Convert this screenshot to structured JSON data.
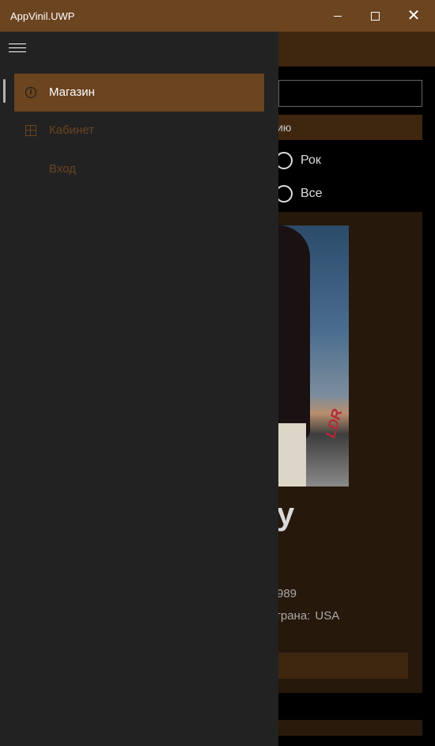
{
  "window": {
    "title": "AppVinil.UWP",
    "minimize_glyph": "",
    "maximize_glyph": "",
    "close_glyph": "✕"
  },
  "nav": {
    "items": [
      {
        "label": "Магазин",
        "icon": "info-icon",
        "selected": true
      },
      {
        "label": "Кабинет",
        "icon": "grid-icon",
        "selected": false
      },
      {
        "label": "Вход",
        "icon": "",
        "selected": false
      }
    ]
  },
  "background": {
    "sort_button_partial": "ию",
    "radio_rock": "Рок",
    "radio_all": "Все",
    "album_title_partial": "y",
    "year_partial": "989",
    "country_label_partial": "трана:",
    "country_value": "USA",
    "cover_logo": "LDR"
  },
  "colors": {
    "accent": "#6b4420",
    "pane": "#222222",
    "page": "#000000"
  }
}
